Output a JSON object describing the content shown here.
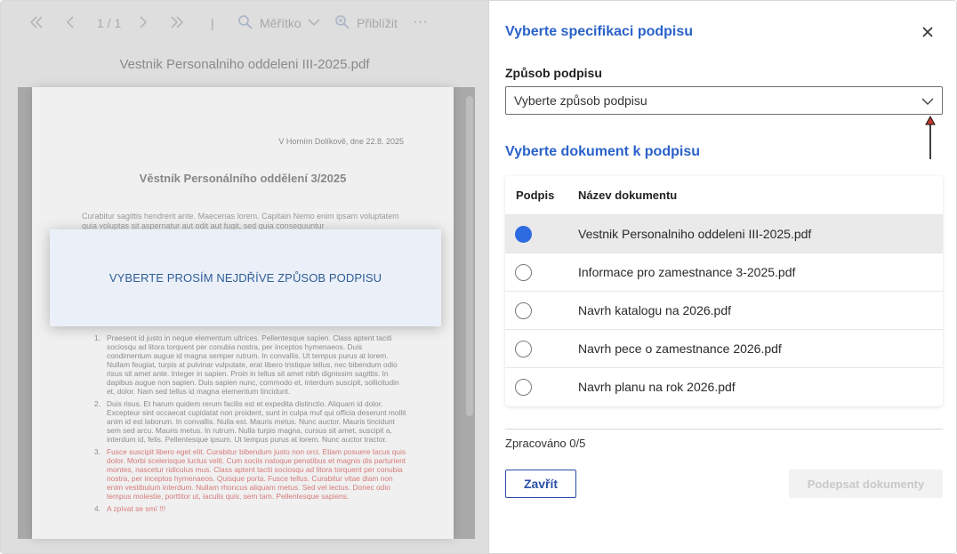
{
  "viewer": {
    "toolbar": {
      "page_indicator": "1 / 1",
      "separator": "|",
      "scale_label": "Měřítko",
      "zoom_in_label": "Přiblížit",
      "more_label": "···"
    },
    "file_title": "Vestnik Personalniho oddeleni III-2025.pdf",
    "document": {
      "dateline": "V Horním Dolíkově, dne 22.8. 2025",
      "heading": "Věstník Personálního oddělení 3/2025",
      "intro": "Curabitur sagittis hendrerit ante. Maecenas lorem. Capitain Nemo enim ipsam voluptatem quia voluptas sit aspernatur aut odit aut fugit, sed quia consequuntur",
      "items": [
        {
          "num": "1.",
          "text": "Praesent id justo in neque elementum ultrices. Pellentesque sapien. Class aptent taciti sociosqu ad litora torquent per conubia nostra, per inceptos hymenaeos. Duis condimentum augue id magna semper rutrum. In convallis. Ut tempus purus at lorem. Nullam feugiat, turpis at pulvinar vulputate, erat libero tristique tellus, nec bibendum odio risus sit amet ante. Integer in sapien. Proin in tellus sit amet nibh dignissim sagittis. In dapibus augue non sapien. Duis sapien nunc, commodo et, interdum suscipit, sollicitudin et, dolor. Nam sed tellus id magna elementum tincidunt."
        },
        {
          "num": "2.",
          "text": "Duis risus. Et harum quidem rerum facilis est et expedita distinctio. Aliquam id dolor. Excepteur sint occaecat cupidatat non proident, sunt in culpa muf qui officia deserunt mollit anim id est laborum. In convallis. Nulla est. Mauris metus. Nunc auctor. Mauris tincidunt sem sed arcu. Mauris metus. In rutrum. Nulla turpis magna, cursus sit amet, suscipit a, interdum id, felis. Pellentesque ipsum. Ut tempus purus at lorem. Nunc auctor tractor."
        },
        {
          "num": "3.",
          "text": "Fusce suscipit libero eget elit. Curabitur bibendum justo non orci. Etiam posuere lacus quis dolor. Morbi scelerisque luctus velit. Cum sociis natoque penatibus et magnis dis parturient montes, nascetur ridiculus mus. Class aptent taciti sociosqu ad litora torquent per conubia nostra, per inceptos hymenaeos. Quisque porta. Fusce tellus. Curabitur vitae diam non enim vestibulum interdum. Nullam rhoncus aliquam metus. Sed vel lectus. Donec odio tempus molestie, porttitor ut, iaculis quis, sem tam. Pellentesque sapiens."
        },
        {
          "num": "4.",
          "text": "A zpívat se smí !!!"
        }
      ]
    },
    "overlay_message": "VYBERTE PROSÍM NEJDŘÍVE ZPŮSOB PODPISU"
  },
  "panel": {
    "title": "Vyberte specifikaci podpisu",
    "method_label": "Způsob podpisu",
    "method_select": "Vyberte způsob podpisu",
    "documents_title": "Vyberte dokument k podpisu",
    "table": {
      "col_sign": "Podpis",
      "col_name": "Název dokumentu",
      "rows": [
        {
          "name": "Vestnik Personalniho oddeleni III-2025.pdf",
          "selected": true
        },
        {
          "name": "Informace pro zamestnance 3-2025.pdf",
          "selected": false
        },
        {
          "name": "Navrh katalogu na 2026.pdf",
          "selected": false
        },
        {
          "name": "Navrh pece o zamestnance 2026.pdf",
          "selected": false
        },
        {
          "name": "Navrh planu na rok 2026.pdf",
          "selected": false
        }
      ]
    },
    "status": "Zpracováno 0/5",
    "close_button": "Zavřít",
    "sign_button": "Podepsat dokumenty"
  },
  "colors": {
    "accent": "#2a62c9",
    "radio_selected": "#2f6be0",
    "annotation_arrow": "#c0392b"
  }
}
